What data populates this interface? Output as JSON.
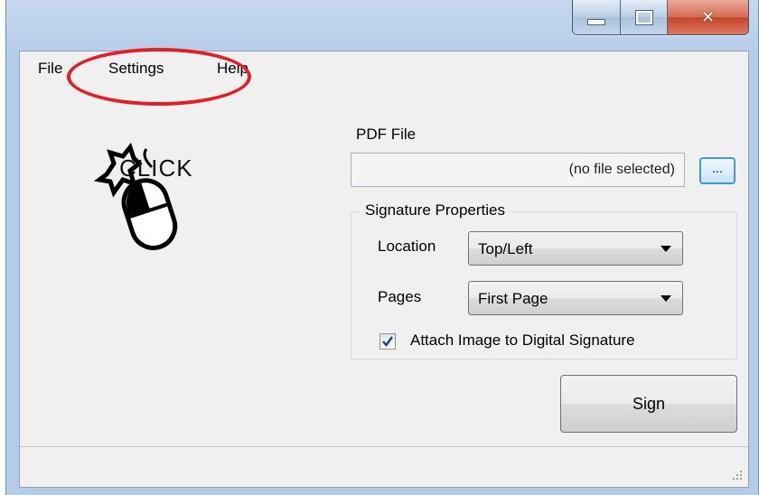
{
  "menu": {
    "file": "File",
    "settings": "Settings",
    "help": "Help"
  },
  "graphic": {
    "click_text": "CLICK",
    "icon": "mouse-click-icon"
  },
  "pdf": {
    "label": "PDF File",
    "value": "(no file selected)",
    "browse_label": "..."
  },
  "signature_properties": {
    "title": "Signature Properties",
    "location_label": "Location",
    "location_value": "Top/Left",
    "pages_label": "Pages",
    "pages_value": "First Page",
    "attach_label": "Attach Image to Digital Signature",
    "attach_checked": true
  },
  "actions": {
    "sign_label": "Sign"
  },
  "colors": {
    "highlight": "#e41e26",
    "close_button": "#c2452a",
    "browse_border": "#3c9ad6"
  }
}
